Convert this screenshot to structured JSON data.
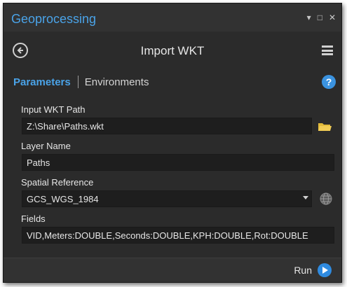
{
  "pane": {
    "title": "Geoprocessing",
    "controls": [
      "▾",
      "□",
      "✕"
    ]
  },
  "header": {
    "title": "Import WKT"
  },
  "tabs": {
    "parameters": "Parameters",
    "environments": "Environments"
  },
  "help": {
    "glyph": "?"
  },
  "params": {
    "input_wkt_path": {
      "label": "Input WKT Path",
      "value": "Z:\\Share\\Paths.wkt"
    },
    "layer_name": {
      "label": "Layer Name",
      "value": "Paths"
    },
    "spatial_reference": {
      "label": "Spatial Reference",
      "value": "GCS_WGS_1984"
    },
    "fields": {
      "label": "Fields",
      "value": "VID,Meters:DOUBLE,Seconds:DOUBLE,KPH:DOUBLE,Rot:DOUBLE"
    }
  },
  "footer": {
    "run_label": "Run"
  },
  "colors": {
    "accent": "#4aa3e8",
    "background": "#2b2b2b",
    "field": "#1e1e1e",
    "folder": "#e0b93a"
  },
  "icons": [
    "back-arrow-icon",
    "menu-icon",
    "help-icon",
    "folder-icon",
    "globe-icon",
    "run-icon"
  ]
}
